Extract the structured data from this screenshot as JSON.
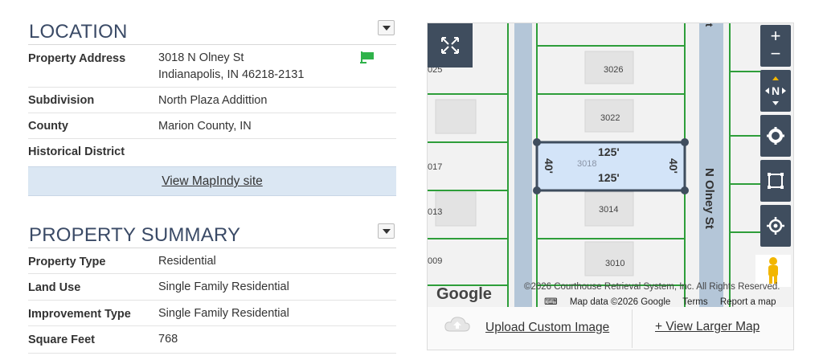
{
  "location": {
    "title": "LOCATION",
    "rows": [
      {
        "label": "Property Address",
        "value_line1": "3018 N Olney St",
        "value_line2": "Indianapolis, IN 46218-2131"
      },
      {
        "label": "Subdivision",
        "value": "North Plaza Addittion"
      },
      {
        "label": "County",
        "value": "Marion County, IN"
      },
      {
        "label": "Historical District",
        "value": ""
      }
    ],
    "mapindy_link": "View MapIndy site"
  },
  "summary": {
    "title": "PROPERTY SUMMARY",
    "rows": [
      {
        "label": "Property Type",
        "value": "Residential"
      },
      {
        "label": "Land Use",
        "value": "Single Family Residential"
      },
      {
        "label": "Improvement Type",
        "value": "Single Family Residential"
      },
      {
        "label": "Square Feet",
        "value": "768"
      }
    ]
  },
  "map": {
    "street_label": "N Olney St",
    "lot_numbers": [
      "3026",
      "3022",
      "3018",
      "3014",
      "3010"
    ],
    "left_lot_partials": [
      "025",
      "017",
      "013",
      "009"
    ],
    "dimensions": {
      "top": "125'",
      "bottom": "125'",
      "left": "40'",
      "right": "40'"
    },
    "google": "Google",
    "attribution": "©2026 Courthouse Retrieval System, Inc. All Rights Reserved.",
    "map_data": "Map data ©2026 Google",
    "terms": "Terms",
    "report": "Report a map error",
    "zoom_in": "+",
    "zoom_out": "−",
    "compass": "N",
    "upload_label": "Upload Custom Image",
    "larger_label": "+ View Larger Map",
    "icons": [
      "fullscreen-icon",
      "compass-icon",
      "gear-icon",
      "select-area-icon",
      "locate-icon",
      "pegman-icon",
      "cloud-upload-icon",
      "keyboard-icon",
      "flag-icon"
    ],
    "colors": {
      "lot_line": "#2e9e3a",
      "selected_fill": "#d3e4f8",
      "selected_stroke": "#3f4d5e",
      "controls": "#3f4d5e"
    }
  }
}
